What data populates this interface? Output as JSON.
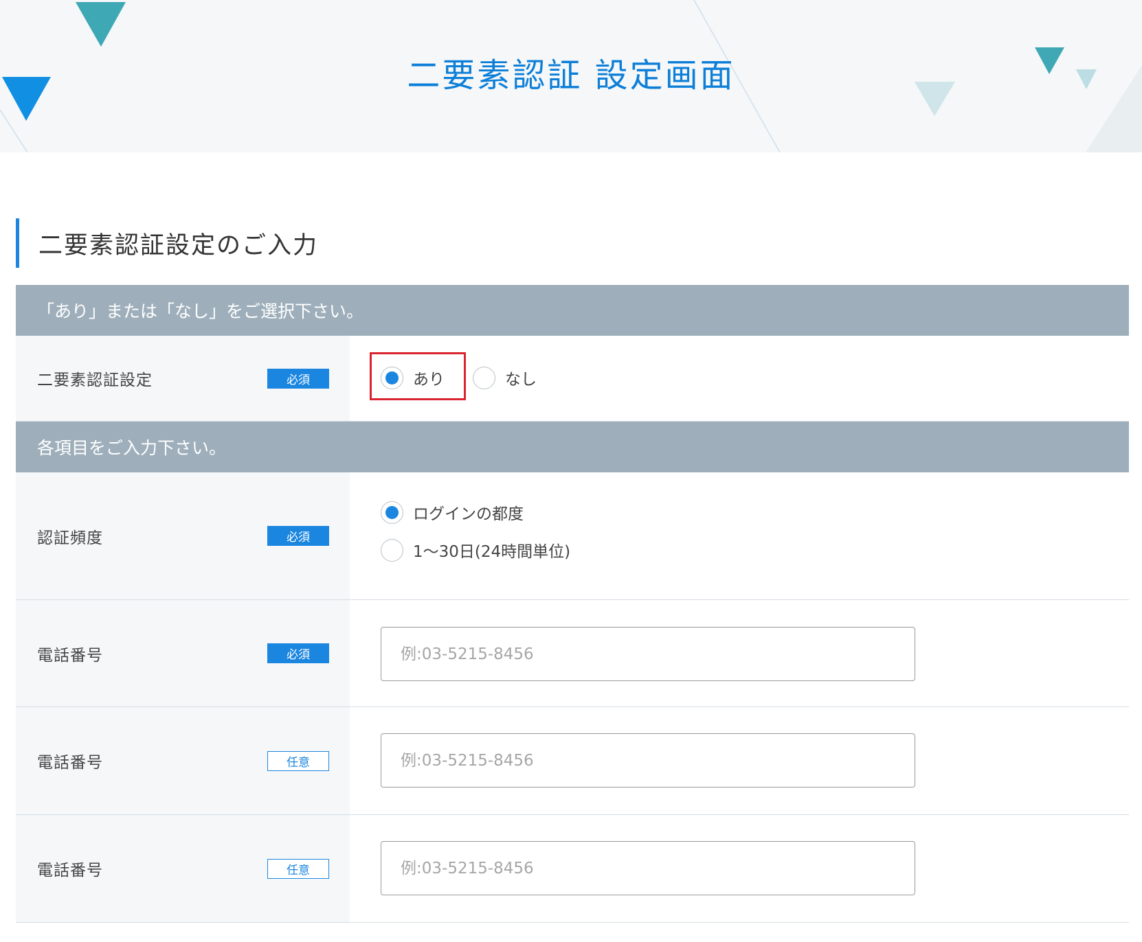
{
  "header": {
    "title": "二要素認証 設定画面"
  },
  "section": {
    "heading": "二要素認証設定のご入力"
  },
  "bands": {
    "select_instruction": "「あり」または「なし」をご選択下さい。",
    "input_instruction": "各項目をご入力下さい。"
  },
  "rows": {
    "two_factor": {
      "label": "二要素認証設定",
      "badge": "必須",
      "options": [
        {
          "label": "あり",
          "checked": true
        },
        {
          "label": "なし",
          "checked": false
        }
      ]
    },
    "frequency": {
      "label": "認証頻度",
      "badge": "必須",
      "options": [
        {
          "label": "ログインの都度",
          "checked": true
        },
        {
          "label": "1〜30日(24時間単位)",
          "checked": false
        }
      ]
    },
    "phone1": {
      "label": "電話番号",
      "badge": "必須",
      "placeholder": "例:03-5215-8456",
      "value": ""
    },
    "phone2": {
      "label": "電話番号",
      "badge": "任意",
      "placeholder": "例:03-5215-8456",
      "value": ""
    },
    "phone3": {
      "label": "電話番号",
      "badge": "任意",
      "placeholder": "例:03-5215-8456",
      "value": ""
    }
  },
  "colors": {
    "accent": "#1b86e0",
    "title": "#0d7fd8",
    "band": "#9eafbb",
    "label_bg": "#f5f7f9",
    "highlight": "#d9232e"
  }
}
